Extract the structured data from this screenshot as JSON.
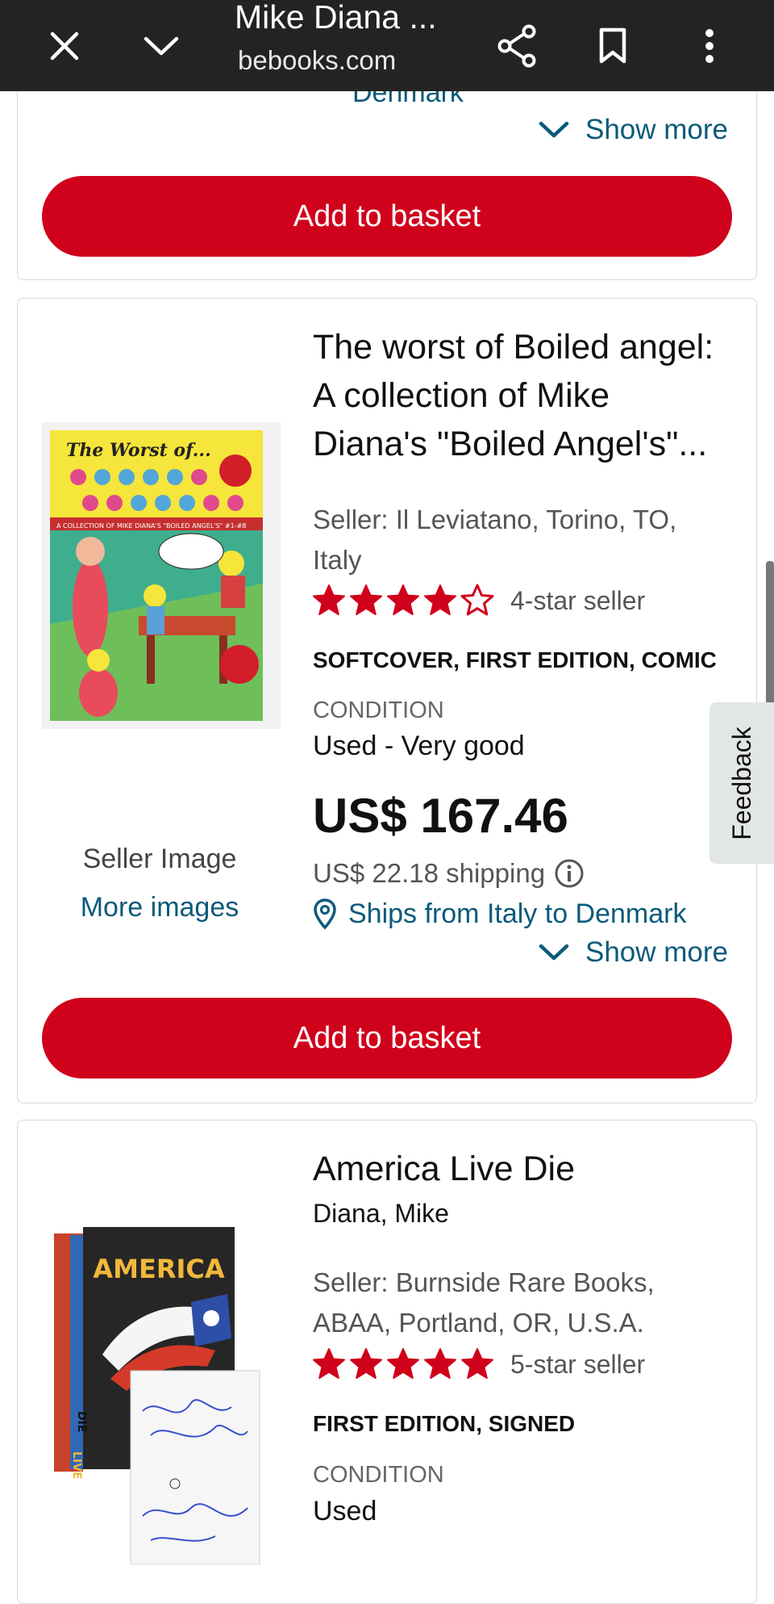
{
  "browser": {
    "title": "Mike Diana ...",
    "url": "bebooks.com",
    "icons": [
      "close-icon",
      "chevron-down-icon",
      "share-icon",
      "bookmark-icon",
      "more-vert-icon"
    ]
  },
  "prev_card": {
    "ships_partial": "Denmark",
    "show_more": "Show more",
    "button": "Add to basket"
  },
  "listing1": {
    "title": "The worst of Boiled an­gel: A collection of Mike Diana's \"Boiled Angel's\"...",
    "seller": "Seller: Il Leviatano, Torino, TO, Italy",
    "rating_stars": 4,
    "rating_text": "4-star seller",
    "binding": "SOFTCOVER, FIRST EDITION, COMIC",
    "condition_label": "CONDITION",
    "condition": "Used - Very good",
    "price": "US$ 167.46",
    "shipping": "US$ 22.18 shipping",
    "ships_from": "Ships from Italy to Denmark",
    "show_more": "Show more",
    "image_caption": "Seller Image",
    "more_images": "More images",
    "button": "Add to basket",
    "cover": {
      "heading": "The Worst of...",
      "word1": "BOILED",
      "word2": "ANGEL",
      "strip": "A COLLECTION OF MIKE DIANA'S \"BOILED ANGEL'S\" #1-#8"
    }
  },
  "listing2": {
    "title": "America Live Die",
    "author": "Diana, Mike",
    "seller": "Seller: Burnside Rare Books, ABAA, Portland, OR, U.S.A.",
    "rating_stars": 5,
    "rating_text": "5-star seller",
    "binding": "FIRST EDITION, SIGNED",
    "condition_label": "CONDITION",
    "condition": "Used",
    "cover": {
      "word": "AMERICA",
      "spine1": "LIVE",
      "spine2": "DIE"
    }
  },
  "feedback": "Feedback",
  "colors": {
    "accent_red": "#d0011b",
    "link_teal": "#0a5a7a",
    "topbar": "#232323"
  }
}
